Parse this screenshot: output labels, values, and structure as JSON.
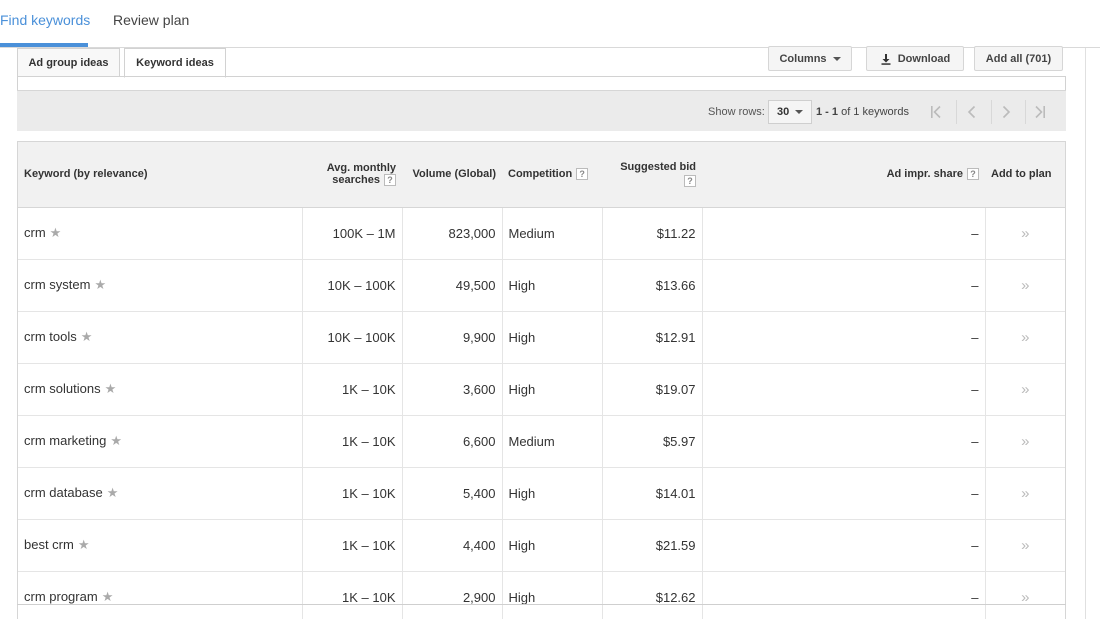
{
  "top_tabs": {
    "find": "Find keywords",
    "review": "Review plan"
  },
  "sub_tabs": {
    "ad_group": "Ad group ideas",
    "keyword": "Keyword ideas"
  },
  "toolbar": {
    "columns": "Columns",
    "download": "Download",
    "add_all": "Add all (701)"
  },
  "pager": {
    "show_rows_label": "Show rows:",
    "rows_value": "30",
    "range_prefix": "1 - 1",
    "range_suffix": "of 1 keywords"
  },
  "table": {
    "headers": {
      "keyword": "Keyword (by relevance)",
      "avg_line1": "Avg. monthly",
      "avg_line2": "searches",
      "volume": "Volume (Global)",
      "competition": "Competition",
      "bid": "Suggested bid",
      "share": "Ad impr. share",
      "add": "Add to plan"
    },
    "rows": [
      {
        "keyword": "crm",
        "avg": "100K – 1M",
        "volume": "823,000",
        "competition": "Medium",
        "bid": "$11.22",
        "share": "–"
      },
      {
        "keyword": "crm system",
        "avg": "10K – 100K",
        "volume": "49,500",
        "competition": "High",
        "bid": "$13.66",
        "share": "–"
      },
      {
        "keyword": "crm tools",
        "avg": "10K – 100K",
        "volume": "9,900",
        "competition": "High",
        "bid": "$12.91",
        "share": "–"
      },
      {
        "keyword": "crm solutions",
        "avg": "1K – 10K",
        "volume": "3,600",
        "competition": "High",
        "bid": "$19.07",
        "share": "–"
      },
      {
        "keyword": "crm marketing",
        "avg": "1K – 10K",
        "volume": "6,600",
        "competition": "Medium",
        "bid": "$5.97",
        "share": "–"
      },
      {
        "keyword": "crm database",
        "avg": "1K – 10K",
        "volume": "5,400",
        "competition": "High",
        "bid": "$14.01",
        "share": "–"
      },
      {
        "keyword": "best crm",
        "avg": "1K – 10K",
        "volume": "4,400",
        "competition": "High",
        "bid": "$21.59",
        "share": "–"
      },
      {
        "keyword": "crm program",
        "avg": "1K – 10K",
        "volume": "2,900",
        "competition": "High",
        "bid": "$12.62",
        "share": "–"
      }
    ]
  }
}
